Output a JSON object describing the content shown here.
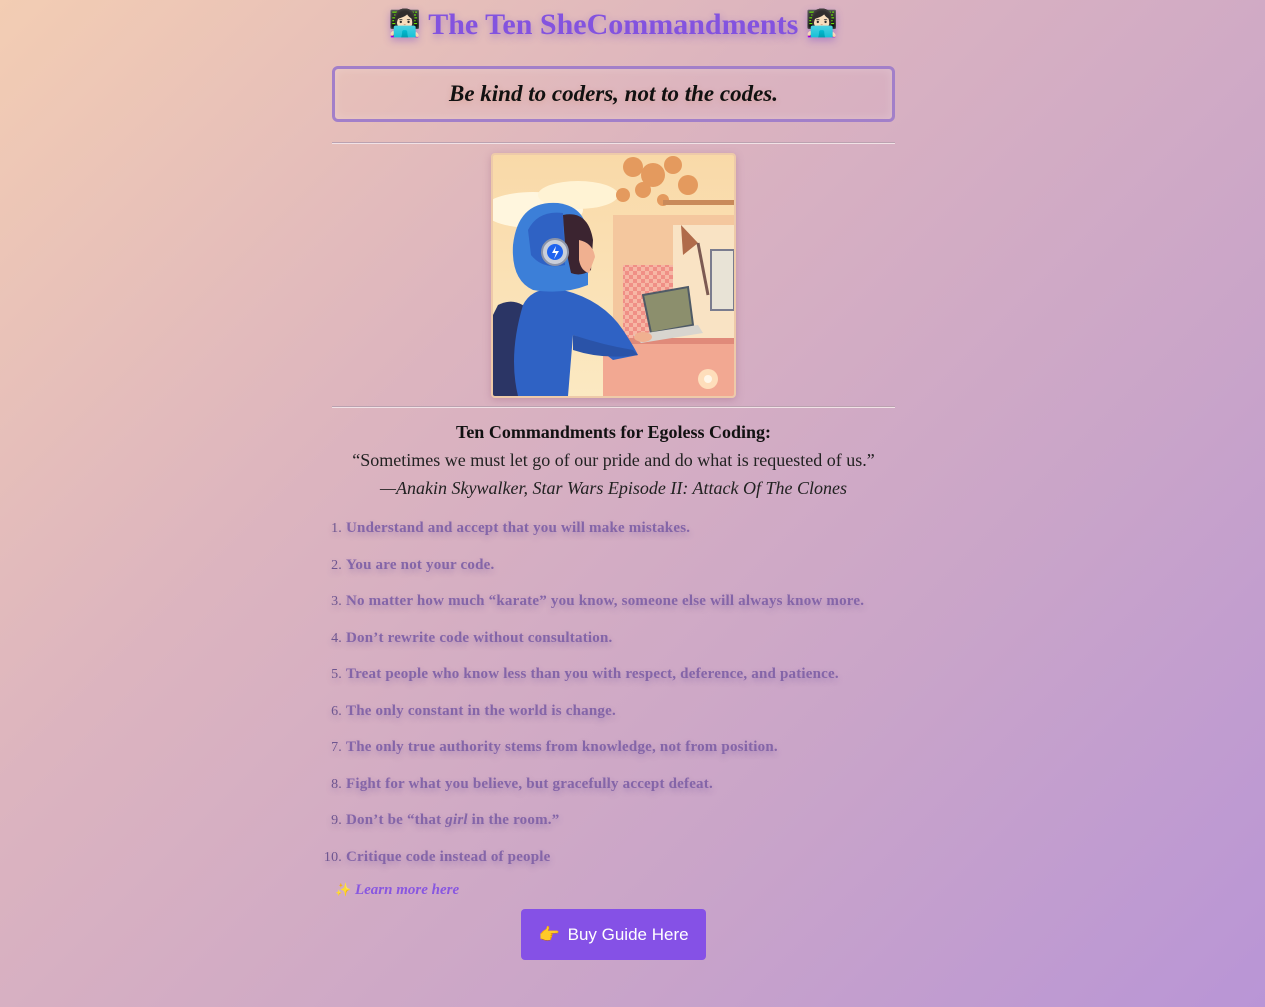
{
  "header": {
    "title": "The Ten SheCommandments",
    "left_icon": "woman-technologist-icon",
    "right_icon": "woman-technologist-icon",
    "left_icon_glyph": "👩🏻‍💻",
    "right_icon_glyph": "👩🏻‍💻"
  },
  "tagline": "Be kind to coders, not to the codes.",
  "illustration": {
    "icon": "girl-coding-illustration"
  },
  "commandments": {
    "heading": "Ten Commandments for Egoless Coding:",
    "epigraph_quote": "“Sometimes we must let go of our pride and do what is requested of us.”",
    "epigraph_attribution": "—Anakin Skywalker, Star Wars Episode II: Attack Of The Clones",
    "items": [
      {
        "text": "Understand and accept that you will make mistakes."
      },
      {
        "text": "You are not your code."
      },
      {
        "text": "No matter how much “karate” you know, someone else will always know more."
      },
      {
        "text": "Don’t rewrite code without consultation."
      },
      {
        "text": "Treat people who know less than you with respect, deference, and patience."
      },
      {
        "text": "The only constant in the world is change."
      },
      {
        "text": "The only true authority stems from knowledge, not from position."
      },
      {
        "text": "Fight for what you believe, but gracefully accept defeat."
      },
      {
        "before": "Don’t be “that ",
        "emphasis": "girl",
        "after": " in the room.”"
      },
      {
        "text": "Critique code instead of people"
      }
    ]
  },
  "learn_more": {
    "icon": "sparkles-icon",
    "glyph": "✨",
    "label": "Learn more here"
  },
  "buy_button": {
    "icon": "pointing-hand-icon",
    "glyph": "👉",
    "label": "Buy Guide Here"
  },
  "colors": {
    "accent": "#8551e6",
    "title": "#8353df",
    "list_text": "#8465a8",
    "box_border": "#a27fc9"
  }
}
